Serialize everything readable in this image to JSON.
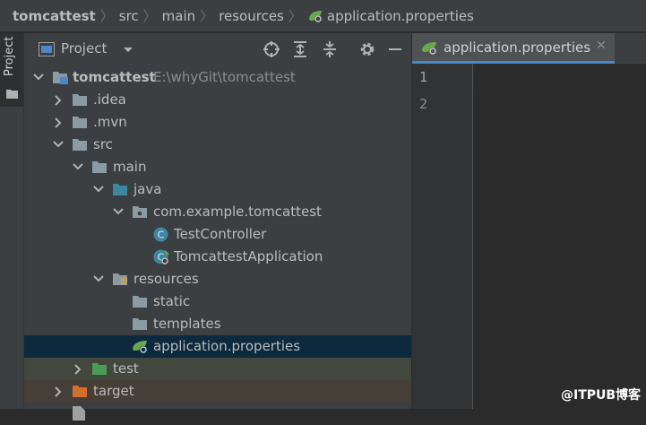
{
  "breadcrumbs": [
    "tomcattest",
    "src",
    "main",
    "resources",
    "application.properties"
  ],
  "tool_window_stripe": {
    "label": "Project"
  },
  "project_panel": {
    "title": "Project",
    "toolbar_icons": [
      "locate-icon",
      "expand-all-icon",
      "collapse-all-icon",
      "gear-icon",
      "hide-icon"
    ]
  },
  "tree": [
    {
      "label": "tomcattest",
      "path": "E:\\whyGit\\tomcattest",
      "icon": "module-folder-icon"
    },
    {
      "label": ".idea",
      "icon": "folder-icon"
    },
    {
      "label": ".mvn",
      "icon": "folder-icon"
    },
    {
      "label": "src",
      "icon": "folder-icon"
    },
    {
      "label": "main",
      "icon": "folder-icon"
    },
    {
      "label": "java",
      "icon": "source-folder-icon"
    },
    {
      "label": "com.example.tomcattest",
      "icon": "package-icon"
    },
    {
      "label": "TestController",
      "icon": "class-icon"
    },
    {
      "label": "TomcattestApplication",
      "icon": "spring-boot-class-icon"
    },
    {
      "label": "resources",
      "icon": "resources-folder-icon"
    },
    {
      "label": "static",
      "icon": "folder-icon"
    },
    {
      "label": "templates",
      "icon": "folder-icon"
    },
    {
      "label": "application.properties",
      "icon": "spring-properties-icon"
    },
    {
      "label": "test",
      "icon": "test-folder-icon"
    },
    {
      "label": "target",
      "icon": "excluded-folder-icon"
    }
  ],
  "editor": {
    "tab_label": "application.properties",
    "line_numbers": [
      "1",
      "2"
    ]
  },
  "watermark": "@ITPUB博客",
  "colors": {
    "selection": "#0d293e",
    "tab_underline": "#4a88c7",
    "folder": "#8b9ba3",
    "source_folder": "#3e86a0",
    "test_folder": "#499c54",
    "excluded_folder": "#d36e2d",
    "spring_green": "#6aa84f"
  }
}
